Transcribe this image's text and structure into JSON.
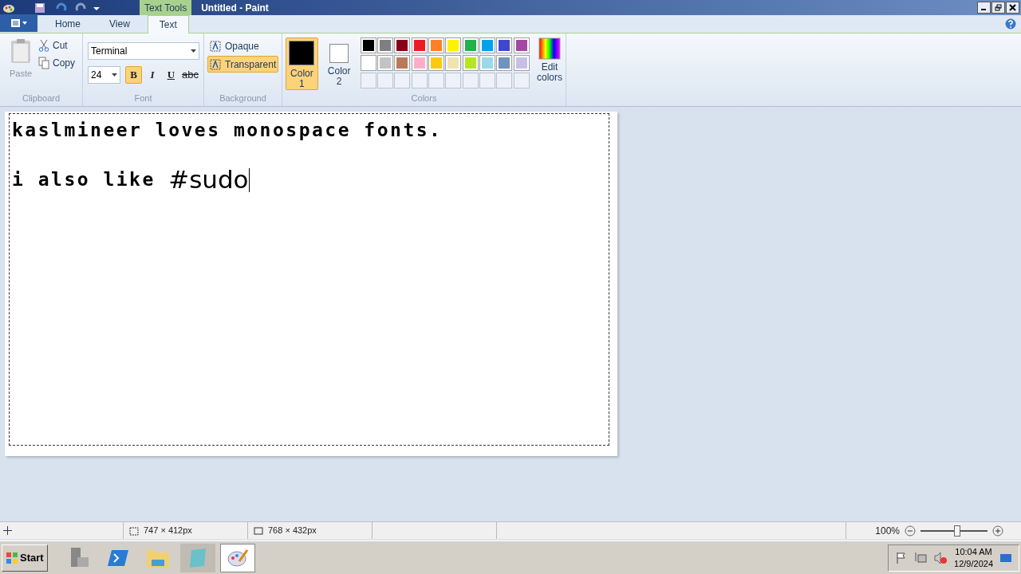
{
  "window": {
    "context_tab": "Text Tools",
    "title": "Untitled - Paint"
  },
  "tabs": [
    {
      "label": "Home",
      "selected": false
    },
    {
      "label": "View",
      "selected": false
    },
    {
      "label": "Text",
      "selected": true
    }
  ],
  "clipboard": {
    "paste": "Paste",
    "cut": "Cut",
    "copy": "Copy",
    "group": "Clipboard"
  },
  "font": {
    "family": "Terminal",
    "size": "24",
    "group": "Font",
    "styles": [
      {
        "kind": "bold",
        "label": "B",
        "selected": true
      },
      {
        "kind": "italic",
        "label": "I",
        "selected": false
      },
      {
        "kind": "underline",
        "label": "U",
        "selected": false
      },
      {
        "kind": "strike",
        "label": "abc",
        "selected": false
      }
    ]
  },
  "background": {
    "group": "Background",
    "options": [
      {
        "label": "Opaque",
        "selected": false
      },
      {
        "label": "Transparent",
        "selected": true
      }
    ]
  },
  "colors": {
    "group": "Colors",
    "slots": [
      {
        "label": "Color\n1",
        "color": "#000000",
        "selected": true
      },
      {
        "label": "Color\n2",
        "color": "#ffffff",
        "selected": false
      }
    ],
    "palette": [
      {
        "color": "#000000"
      },
      {
        "color": "#7f7f7f"
      },
      {
        "color": "#880015"
      },
      {
        "color": "#ed1c24"
      },
      {
        "color": "#ff7f27"
      },
      {
        "color": "#fff200"
      },
      {
        "color": "#22b14c"
      },
      {
        "color": "#00a2e8"
      },
      {
        "color": "#3f48cc"
      },
      {
        "color": "#a349a4"
      },
      {
        "color": "#ffffff"
      },
      {
        "color": "#c3c3c3"
      },
      {
        "color": "#b97a57"
      },
      {
        "color": "#ffaec9"
      },
      {
        "color": "#ffc90e"
      },
      {
        "color": "#efe4b0"
      },
      {
        "color": "#b5e61d"
      },
      {
        "color": "#99d9ea"
      },
      {
        "color": "#7092be"
      },
      {
        "color": "#c8bfe7"
      }
    ],
    "edit": "Edit\ncolors"
  },
  "canvas": {
    "caret": true,
    "lines": [
      {
        "segments": [
          {
            "kind": "pixel",
            "text": "kaslmineer loves monospace fonts."
          }
        ]
      },
      {
        "segments": [
          {
            "kind": "pixel",
            "text": "i also like "
          },
          {
            "kind": "large",
            "text": "#sudo"
          }
        ]
      }
    ]
  },
  "status_bar": {
    "selection": "747 × 412px",
    "size": "768 × 432px",
    "zoom": "100%",
    "zoom_level": {
      "level": 0.55
    }
  },
  "taskbar": {
    "start": "Start",
    "time": "10:04 AM",
    "date": "12/9/2024"
  }
}
